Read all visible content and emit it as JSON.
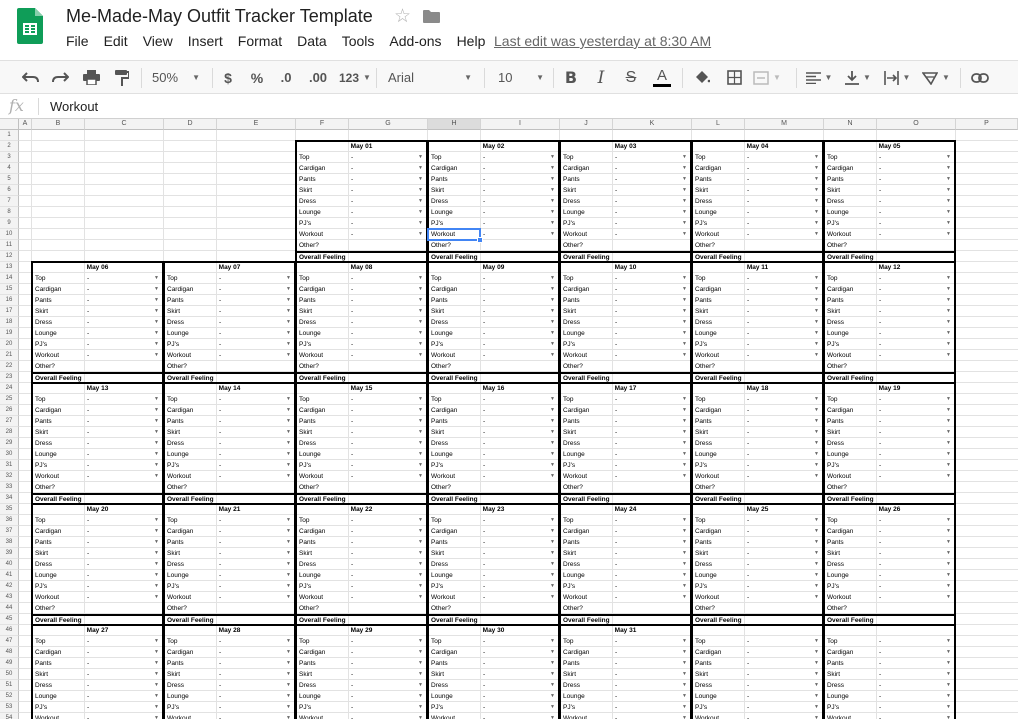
{
  "document": {
    "title": "Me-Made-May Outfit Tracker Template",
    "last_edit": "Last edit was yesterday at 8:30 AM"
  },
  "menu": [
    "File",
    "Edit",
    "View",
    "Insert",
    "Format",
    "Data",
    "Tools",
    "Add-ons",
    "Help"
  ],
  "toolbar": {
    "zoom": "50%",
    "currency": "$",
    "percent": "%",
    "decrease_decimal": ".0",
    "increase_decimal": ".00",
    "more_formats": "123",
    "font": "Arial",
    "font_size": "10",
    "bold": "B",
    "italic": "I",
    "strike": "S",
    "text_color": "A",
    "icons": [
      "undo-icon",
      "redo-icon",
      "print-icon",
      "paint-format-icon",
      "fill-color-icon",
      "borders-icon",
      "merge-cells-icon",
      "align-left-icon",
      "valign-bottom-icon",
      "text-wrap-icon",
      "text-rotate-icon",
      "link-icon"
    ]
  },
  "formula_bar": {
    "fx": "fx",
    "value": "Workout"
  },
  "columns": [
    "A",
    "B",
    "C",
    "D",
    "E",
    "F",
    "G",
    "H",
    "I",
    "J",
    "K",
    "L",
    "M",
    "N",
    "O",
    "P"
  ],
  "rows": [
    "1",
    "2",
    "3",
    "4",
    "5",
    "6",
    "7",
    "8",
    "9",
    "10",
    "11",
    "12",
    "13",
    "14",
    "15",
    "16",
    "17",
    "18",
    "19",
    "20",
    "21",
    "22",
    "23",
    "24",
    "25",
    "26",
    "27",
    "28",
    "29",
    "30",
    "31",
    "32",
    "33",
    "34",
    "35",
    "36",
    "37",
    "38",
    "39",
    "40",
    "41",
    "42",
    "43",
    "44",
    "45",
    "46",
    "47",
    "48",
    "49",
    "50",
    "51",
    "52",
    "53",
    "54"
  ],
  "tracker": {
    "categories": [
      "Top",
      "Cardigan",
      "Pants",
      "Skirt",
      "Dress",
      "Lounge",
      "PJ's",
      "Workout"
    ],
    "default_value": "-",
    "other_label": "Other?",
    "feeling_label": "Overall Feeling",
    "days": [
      "May 01",
      "May 02",
      "May 03",
      "May 04",
      "May 05",
      "May 06",
      "May 07",
      "May 08",
      "May 09",
      "May 10",
      "May 11",
      "May 12",
      "May 13",
      "May 14",
      "May 15",
      "May 16",
      "May 17",
      "May 18",
      "May 19",
      "May 20",
      "May 21",
      "May 22",
      "May 23",
      "May 24",
      "May 25",
      "May 26",
      "May 27",
      "May 28",
      "May 29",
      "May 30",
      "May 31"
    ]
  },
  "colors": {
    "logo_green": "#0f9d58",
    "selection_blue": "#4285f4",
    "header_bg": "#f3f3f3"
  }
}
